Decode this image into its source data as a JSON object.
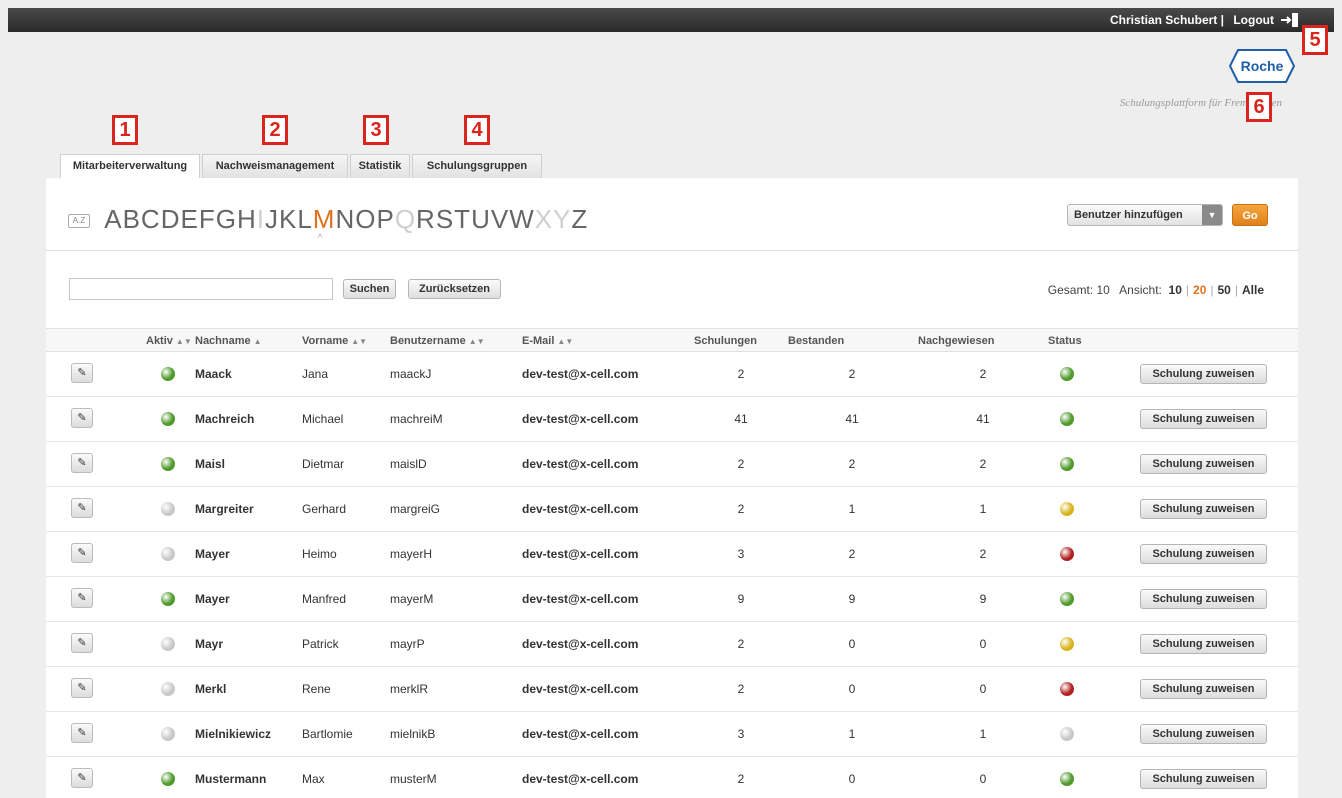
{
  "header": {
    "user": "Christian Schubert  |",
    "logout": "Logout",
    "brand": "Roche",
    "tagline": "Schulungsplattform für Fremdfirmen"
  },
  "callouts": [
    "1",
    "2",
    "3",
    "4",
    "5",
    "6"
  ],
  "tabs": [
    {
      "label": "Mitarbeiterverwaltung",
      "active": true
    },
    {
      "label": "Nachweismanagement"
    },
    {
      "label": "Statistik"
    },
    {
      "label": "Schulungsgruppen"
    }
  ],
  "alphabet": {
    "az_label": "A.Z",
    "letters": [
      {
        "l": "A"
      },
      {
        "l": "B"
      },
      {
        "l": "C"
      },
      {
        "l": "D"
      },
      {
        "l": "E"
      },
      {
        "l": "F"
      },
      {
        "l": "G"
      },
      {
        "l": "H"
      },
      {
        "l": "I",
        "disabled": true
      },
      {
        "l": "J"
      },
      {
        "l": "K"
      },
      {
        "l": "L"
      },
      {
        "l": "M",
        "selected": true
      },
      {
        "l": "N"
      },
      {
        "l": "O"
      },
      {
        "l": "P"
      },
      {
        "l": "Q",
        "disabled": true
      },
      {
        "l": "R"
      },
      {
        "l": "S"
      },
      {
        "l": "T"
      },
      {
        "l": "U"
      },
      {
        "l": "V"
      },
      {
        "l": "W"
      },
      {
        "l": "X",
        "disabled": true
      },
      {
        "l": "Y",
        "disabled": true
      },
      {
        "l": "Z"
      }
    ],
    "caret": "^"
  },
  "actions": {
    "add_select": "Benutzer hinzufügen",
    "go": "Go"
  },
  "search": {
    "value": "",
    "search_button": "Suchen",
    "reset_button": "Zurücksetzen"
  },
  "pager": {
    "total_label": "Gesamt: 10",
    "view_label": "Ansicht:",
    "options": [
      "10",
      "20",
      "50",
      "Alle"
    ],
    "selected": "20"
  },
  "table": {
    "headers": {
      "aktiv": "Aktiv",
      "nachname": "Nachname",
      "vorname": "Vorname",
      "benutzername": "Benutzername",
      "email": "E-Mail",
      "schulungen": "Schulungen",
      "bestanden": "Bestanden",
      "nachgewiesen": "Nachgewiesen",
      "status": "Status"
    },
    "assign_label": "Schulung zuweisen",
    "status_colors": {
      "green": "#4f9a2a",
      "grey": "#c8c8c8",
      "yellow": "#d9b31c",
      "red": "#b22020"
    },
    "rows": [
      {
        "active": true,
        "nachname": "Maack",
        "vorname": "Jana",
        "benutzer": "maackJ",
        "email": "dev-test@x-cell.com",
        "schulungen": "2",
        "bestanden": "2",
        "nachgewiesen": "2",
        "status": "green"
      },
      {
        "active": true,
        "nachname": "Machreich",
        "vorname": "Michael",
        "benutzer": "machreiM",
        "email": "dev-test@x-cell.com",
        "schulungen": "41",
        "bestanden": "41",
        "nachgewiesen": "41",
        "status": "green"
      },
      {
        "active": true,
        "nachname": "Maisl",
        "vorname": "Dietmar",
        "benutzer": "maislD",
        "email": "dev-test@x-cell.com",
        "schulungen": "2",
        "bestanden": "2",
        "nachgewiesen": "2",
        "status": "green"
      },
      {
        "active": false,
        "nachname": "Margreiter",
        "vorname": "Gerhard",
        "benutzer": "margreiG",
        "email": "dev-test@x-cell.com",
        "schulungen": "2",
        "bestanden": "1",
        "nachgewiesen": "1",
        "status": "yellow"
      },
      {
        "active": false,
        "nachname": "Mayer",
        "vorname": "Heimo",
        "benutzer": "mayerH",
        "email": "dev-test@x-cell.com",
        "schulungen": "3",
        "bestanden": "2",
        "nachgewiesen": "2",
        "status": "red"
      },
      {
        "active": true,
        "nachname": "Mayer",
        "vorname": "Manfred",
        "benutzer": "mayerM",
        "email": "dev-test@x-cell.com",
        "schulungen": "9",
        "bestanden": "9",
        "nachgewiesen": "9",
        "status": "green"
      },
      {
        "active": false,
        "nachname": "Mayr",
        "vorname": "Patrick",
        "benutzer": "mayrP",
        "email": "dev-test@x-cell.com",
        "schulungen": "2",
        "bestanden": "0",
        "nachgewiesen": "0",
        "status": "yellow"
      },
      {
        "active": false,
        "nachname": "Merkl",
        "vorname": "Rene",
        "benutzer": "merklR",
        "email": "dev-test@x-cell.com",
        "schulungen": "2",
        "bestanden": "0",
        "nachgewiesen": "0",
        "status": "red"
      },
      {
        "active": false,
        "nachname": "Mielnikiewicz",
        "vorname": "Bartlomie",
        "benutzer": "mielnikB",
        "email": "dev-test@x-cell.com",
        "schulungen": "3",
        "bestanden": "1",
        "nachgewiesen": "1",
        "status": "grey"
      },
      {
        "active": true,
        "nachname": "Mustermann",
        "vorname": "Max",
        "benutzer": "musterM",
        "email": "dev-test@x-cell.com",
        "schulungen": "2",
        "bestanden": "0",
        "nachgewiesen": "0",
        "status": "green"
      }
    ]
  }
}
